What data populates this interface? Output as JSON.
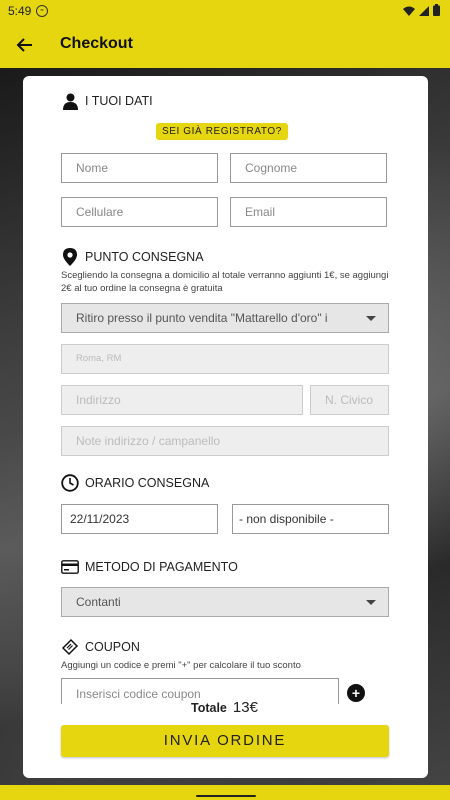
{
  "status_bar": {
    "time": "5:49",
    "indicator": "≈"
  },
  "app_bar": {
    "title": "Checkout",
    "back_icon": "arrow-left-icon"
  },
  "personal": {
    "title": "I TUOI DATI",
    "registered_button": "SEI GIÀ REGISTRATO?",
    "first_name_placeholder": "Nome",
    "last_name_placeholder": "Cognome",
    "phone_placeholder": "Cellulare",
    "email_placeholder": "Email"
  },
  "delivery": {
    "title": "PUNTO CONSEGNA",
    "note": "Scegliendo la consegna a domicilio al totale verranno aggiunti 1€, se aggiungi 2€ al tuo ordine la consegna è gratuita",
    "point_select": "Ritiro presso il punto vendita \"Mattarello d'oro\" i",
    "city": "Roma, RM",
    "address_placeholder": "Indirizzo",
    "civic_placeholder": "N. Civico",
    "notes_placeholder": "Note indirizzo / campanello"
  },
  "schedule": {
    "title": "ORARIO CONSEGNA",
    "date": "22/11/2023",
    "time": "- non disponibile -"
  },
  "payment": {
    "title": "METODO DI PAGAMENTO",
    "method": "Contanti"
  },
  "coupon": {
    "title": "COUPON",
    "note": "Aggiungi un codice e premi \"+\" per calcolare il tuo sconto",
    "placeholder": "Inserisci codice coupon",
    "add_label": "+"
  },
  "total": {
    "label": "Totale",
    "value": "13€"
  },
  "submit": {
    "label": "INVIA ORDINE"
  },
  "colors": {
    "accent": "#e6d610",
    "text": "#222222"
  }
}
